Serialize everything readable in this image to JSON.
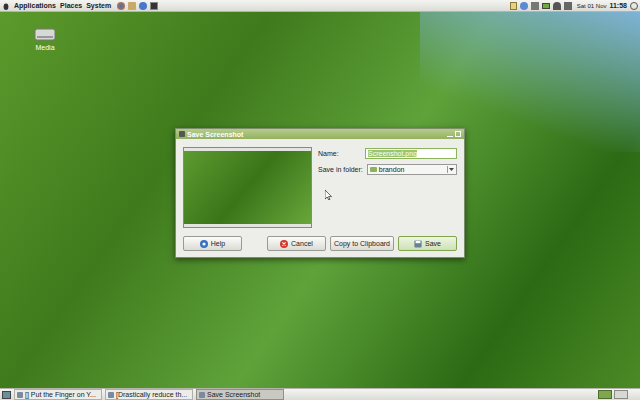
{
  "top_panel": {
    "menus": [
      "Applications",
      "Places",
      "System"
    ],
    "date": "Sat 01 Nov",
    "time": "11:58"
  },
  "desktop_icons": [
    {
      "label": "Media"
    }
  ],
  "dialog": {
    "title": "Save Screenshot",
    "fields": [
      {
        "label": "Name:",
        "value": "Screenshot.png",
        "kind": "entry",
        "focused": true
      },
      {
        "label": "Save in folder:",
        "value": "brandon",
        "kind": "combo",
        "focused": false
      }
    ],
    "buttons": [
      {
        "label": "Help",
        "kind": "help",
        "default": false
      },
      {
        "label": "Cancel",
        "kind": "cancel",
        "default": false
      },
      {
        "label": "Copy to Clipboard",
        "kind": "plain",
        "default": false
      },
      {
        "label": "Save",
        "kind": "save",
        "default": true
      }
    ]
  },
  "taskbar": [
    {
      "label": "[] Put the Finger on Y...",
      "selected": false
    },
    {
      "label": "[Drastically reduce th...",
      "selected": false
    },
    {
      "label": "Save Screenshot",
      "selected": true
    }
  ],
  "workspaces": [
    {
      "selected": true
    },
    {
      "selected": false
    }
  ]
}
